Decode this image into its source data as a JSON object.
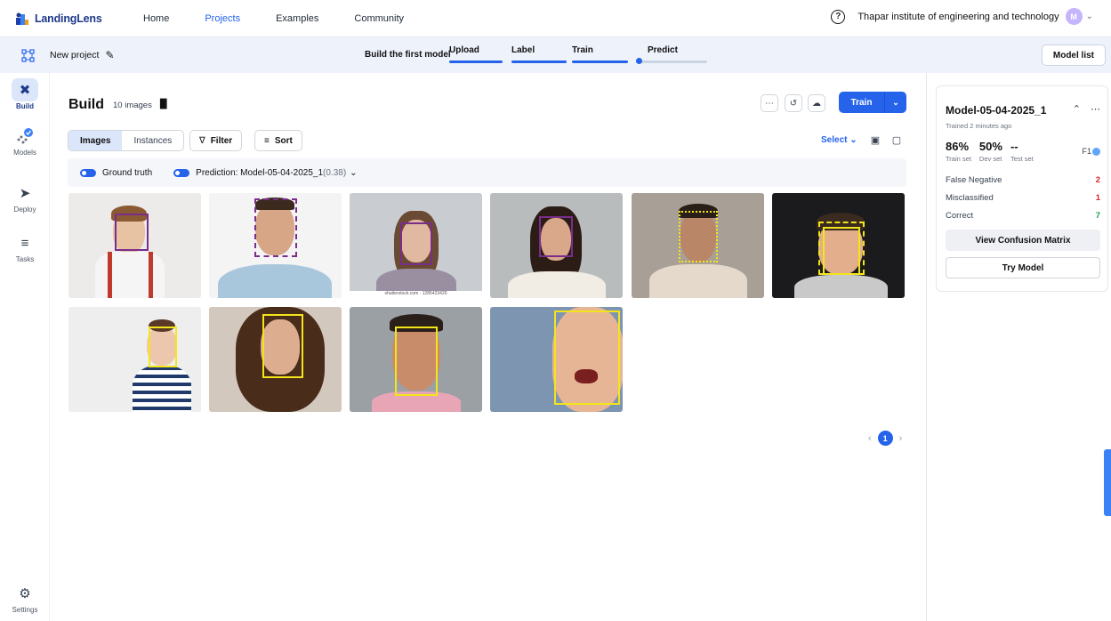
{
  "topbar": {
    "logo_text": "LandingLens",
    "nav": [
      "Home",
      "Projects",
      "Examples",
      "Community"
    ],
    "active_nav": "Projects",
    "org_name": "Thapar institute of engineering and technology",
    "avatar_initial": "M"
  },
  "subbar": {
    "project_name": "New project",
    "steps_label": "Build the first model",
    "steps": [
      "Upload",
      "Label",
      "Train",
      "Predict"
    ],
    "model_list_label": "Model list"
  },
  "sidebar": {
    "items": [
      {
        "label": "Build",
        "icon": "tools-icon",
        "active": true
      },
      {
        "label": "Models",
        "icon": "models-icon",
        "active": false
      },
      {
        "label": "Deploy",
        "icon": "rocket-icon",
        "active": false
      },
      {
        "label": "Tasks",
        "icon": "tasks-icon",
        "active": false
      }
    ],
    "settings_label": "Settings"
  },
  "main": {
    "title": "Build",
    "image_count": "10 images",
    "train_label": "Train",
    "tabs": [
      "Images",
      "Instances"
    ],
    "active_tab": "Images",
    "filter_label": "Filter",
    "sort_label": "Sort",
    "select_label": "Select",
    "toggles": {
      "ground_truth": "Ground truth",
      "prediction": "Prediction: Model-05-04-2025_1",
      "threshold": "(0.38)"
    },
    "thumb_caption": "shutterstock.com · 1285423420",
    "page": "1"
  },
  "panel": {
    "model_name": "Model-05-04-2025_1",
    "trained_ago": "Trained 2 minutes ago",
    "metrics": [
      {
        "value": "86%",
        "label": "Train set"
      },
      {
        "value": "50%",
        "label": "Dev set"
      },
      {
        "value": "--",
        "label": "Test set"
      }
    ],
    "metric_type": "F1",
    "stats": [
      {
        "label": "False Negative",
        "value": "2",
        "color": "#dc2626"
      },
      {
        "label": "Misclassified",
        "value": "1",
        "color": "#dc2626"
      },
      {
        "label": "Correct",
        "value": "7",
        "color": "#16a34a"
      }
    ],
    "confusion_label": "View Confusion Matrix",
    "try_label": "Try Model"
  },
  "colors": {
    "accent": "#2563eb",
    "ground_truth_box": "#7b2d8b",
    "prediction_box": "#f3e51a"
  }
}
